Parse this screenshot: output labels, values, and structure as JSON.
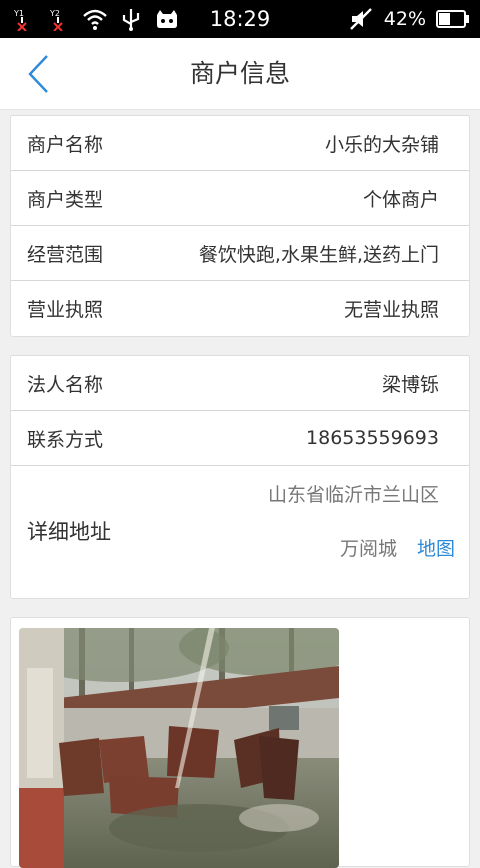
{
  "status_bar": {
    "time": "18:29",
    "battery": "42%",
    "icons": [
      "signal-1-icon",
      "signal-2-icon",
      "wifi-icon",
      "usb-icon",
      "game-icon",
      "mute-icon",
      "battery-icon"
    ]
  },
  "header": {
    "title": "商户信息",
    "back_icon": "chevron-left-icon"
  },
  "merchant": {
    "name_label": "商户名称",
    "name_value": "小乐的大杂铺",
    "type_label": "商户类型",
    "type_value": "个体商户",
    "scope_label": "经营范围",
    "scope_value": "餐饮快跑,水果生鲜,送药上门",
    "license_label": "营业执照",
    "license_value": "无营业执照"
  },
  "legal": {
    "person_label": "法人名称",
    "person_value": "梁博铄",
    "contact_label": "联系方式",
    "contact_value": "18653559693",
    "address_label": "详细地址",
    "address_line1": "山东省临沂市兰山区",
    "address_line2": "万阅城",
    "map_label": "地图"
  },
  "colors": {
    "accent": "#2d8ad8",
    "text": "#333333",
    "muted": "#777777"
  }
}
